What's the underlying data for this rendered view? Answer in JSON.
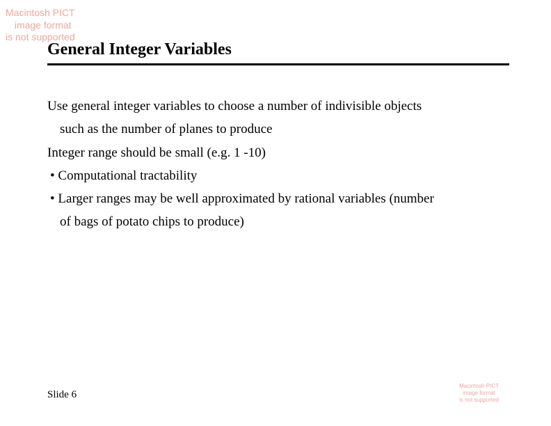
{
  "watermark_tl": "Macintosh PICT\n  image format\nis not supported",
  "watermark_br": "Macintosh PICT\nimage format\nis not supported",
  "title": "General Integer Variables",
  "lines": {
    "l1": "Use general integer variables to choose a number of indivisible objects",
    "l2": "such as the number of planes to produce",
    "l3": "Integer range should be small (e.g. 1 -10)",
    "l4": "• Computational tractability",
    "l5": "• Larger ranges may be well approximated by rational variables (number",
    "l6": "of bags of potato chips to produce)"
  },
  "footer": "Slide 6"
}
